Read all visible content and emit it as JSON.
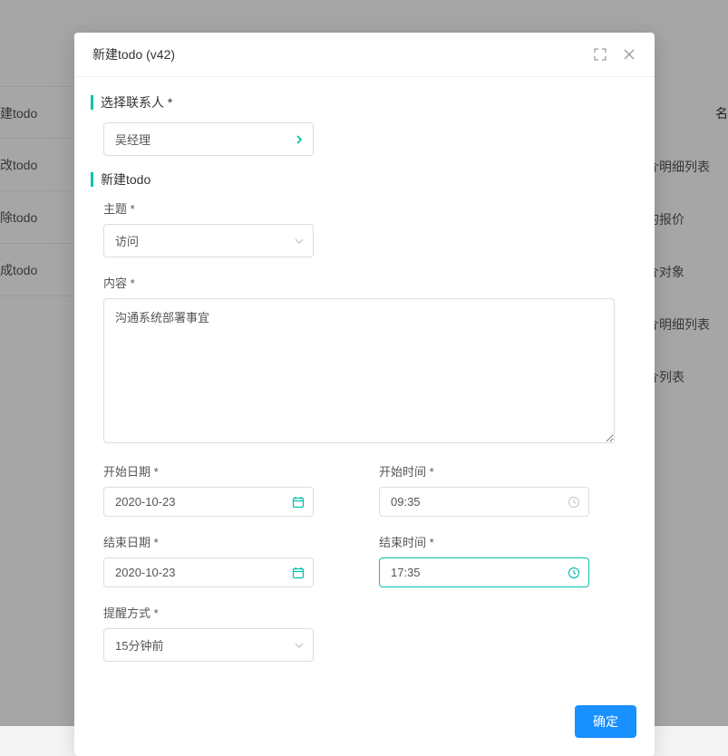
{
  "modal": {
    "title": "新建todo (v42)",
    "sections": {
      "contact": {
        "title": "选择联系人 *",
        "value": "吴经理"
      },
      "todo": {
        "title": "新建todo",
        "subject_label": "主题 *",
        "subject_value": "访问",
        "content_label": "内容 *",
        "content_value": "沟通系统部署事宜",
        "start_date_label": "开始日期 *",
        "start_date_value": "2020-10-23",
        "start_time_label": "开始时间 *",
        "start_time_value": "09:35",
        "end_date_label": "结束日期 *",
        "end_date_value": "2020-10-23",
        "end_time_label": "结束时间 *",
        "end_time_value": "17:35",
        "reminder_label": "提醒方式 *",
        "reminder_value": "15分钟前"
      }
    },
    "confirm_label": "确定"
  },
  "background": {
    "header_col": "名",
    "left_menu": [
      "建todo",
      "改todo",
      "除todo",
      "成todo"
    ],
    "right_col": [
      "介明细列表",
      "的报价",
      "介对象",
      "介明细列表",
      "介列表"
    ]
  }
}
